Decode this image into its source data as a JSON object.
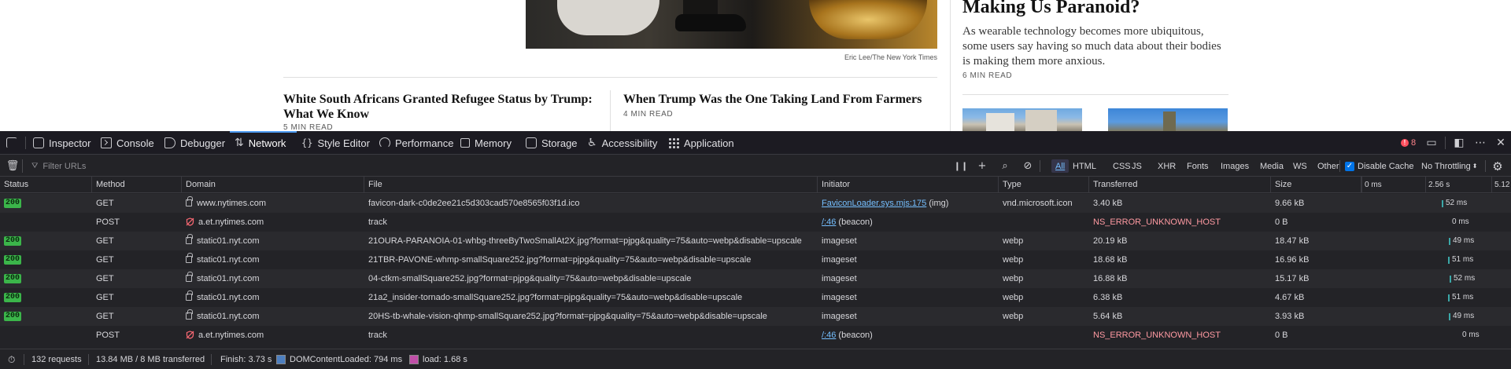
{
  "webpage": {
    "hero_caption": "Eric Lee/The New York Times",
    "story_left_title": "White South Africans Granted Refugee Status by Trump: What We Know",
    "story_left_readtime": "5 MIN READ",
    "story_right_title": "When Trump Was the One Taking Land From Farmers",
    "story_right_readtime": "4 MIN READ",
    "side_title": "Making Us Paranoid?",
    "side_summary": "As wearable technology becomes more ubiquitous, some users say having so much data about their bodies is making them more anxious.",
    "side_readtime": "6 MIN READ"
  },
  "devtools": {
    "tabs": [
      {
        "label": "Inspector",
        "icon": "inspector-icon"
      },
      {
        "label": "Console",
        "icon": "console-icon"
      },
      {
        "label": "Debugger",
        "icon": "debugger-icon"
      },
      {
        "label": "Network",
        "icon": "network-icon"
      },
      {
        "label": "Style Editor",
        "icon": "style-editor-icon"
      },
      {
        "label": "Performance",
        "icon": "performance-icon"
      },
      {
        "label": "Memory",
        "icon": "memory-icon"
      },
      {
        "label": "Storage",
        "icon": "storage-icon"
      },
      {
        "label": "Accessibility",
        "icon": "accessibility-icon"
      },
      {
        "label": "Application",
        "icon": "application-icon"
      }
    ],
    "active_tab": "Network",
    "error_count": "8",
    "filter_placeholder": "Filter URLs",
    "type_filters": [
      "All",
      "HTML",
      "CSS",
      "JS",
      "XHR",
      "Fonts",
      "Images",
      "Media",
      "WS",
      "Other"
    ],
    "active_filter": "All",
    "disable_cache_label": "Disable Cache",
    "disable_cache_checked": true,
    "throttling": "No Throttling",
    "columns": [
      "Status",
      "Method",
      "Domain",
      "File",
      "Initiator",
      "Type",
      "Transferred",
      "Size"
    ],
    "waterfall_ticks": [
      "0 ms",
      "2.56 s",
      "5.12"
    ],
    "rows": [
      {
        "status": "200",
        "method": "GET",
        "domain": "www.nytimes.com",
        "secure": true,
        "file": "favicon-dark-c0de2ee21c5d303cad570e8565f03f1d.ico",
        "initiator_link": "FaviconLoader.sys.mjs:175",
        "initiator_suffix": "(img)",
        "type": "vnd.microsoft.icon",
        "transferred": "3.40 kB",
        "size": "9.66 kB",
        "duration": "52 ms",
        "error": false
      },
      {
        "status": "",
        "method": "POST",
        "domain": "a.et.nytimes.com",
        "secure": false,
        "file": "track",
        "initiator_link": "/:46",
        "initiator_suffix": "(beacon)",
        "type": "",
        "transferred": "NS_ERROR_UNKNOWN_HOST",
        "size": "0 B",
        "duration": "0 ms",
        "error": true
      },
      {
        "status": "200",
        "method": "GET",
        "domain": "static01.nyt.com",
        "secure": true,
        "file": "21OURA-PARANOIA-01-whbg-threeByTwoSmallAt2X.jpg?format=pjpg&quality=75&auto=webp&disable=upscale",
        "initiator_link": "",
        "initiator_suffix": "imageset",
        "type": "webp",
        "transferred": "20.19 kB",
        "size": "18.47 kB",
        "duration": "49 ms",
        "error": false
      },
      {
        "status": "200",
        "method": "GET",
        "domain": "static01.nyt.com",
        "secure": true,
        "file": "21TBR-PAVONE-whmp-smallSquare252.jpg?format=pjpg&quality=75&auto=webp&disable=upscale",
        "initiator_link": "",
        "initiator_suffix": "imageset",
        "type": "webp",
        "transferred": "18.68 kB",
        "size": "16.96 kB",
        "duration": "51 ms",
        "error": false
      },
      {
        "status": "200",
        "method": "GET",
        "domain": "static01.nyt.com",
        "secure": true,
        "file": "04-ctkm-smallSquare252.jpg?format=pjpg&quality=75&auto=webp&disable=upscale",
        "initiator_link": "",
        "initiator_suffix": "imageset",
        "type": "webp",
        "transferred": "16.88 kB",
        "size": "15.17 kB",
        "duration": "52 ms",
        "error": false
      },
      {
        "status": "200",
        "method": "GET",
        "domain": "static01.nyt.com",
        "secure": true,
        "file": "21a2_insider-tornado-smallSquare252.jpg?format=pjpg&quality=75&auto=webp&disable=upscale",
        "initiator_link": "",
        "initiator_suffix": "imageset",
        "type": "webp",
        "transferred": "6.38 kB",
        "size": "4.67 kB",
        "duration": "51 ms",
        "error": false
      },
      {
        "status": "200",
        "method": "GET",
        "domain": "static01.nyt.com",
        "secure": true,
        "file": "20HS-tb-whale-vision-qhmp-smallSquare252.jpg?format=pjpg&quality=75&auto=webp&disable=upscale",
        "initiator_link": "",
        "initiator_suffix": "imageset",
        "type": "webp",
        "transferred": "5.64 kB",
        "size": "3.93 kB",
        "duration": "49 ms",
        "error": false
      },
      {
        "status": "",
        "method": "POST",
        "domain": "a.et.nytimes.com",
        "secure": false,
        "file": "track",
        "initiator_link": "/:46",
        "initiator_suffix": "(beacon)",
        "type": "",
        "transferred": "NS_ERROR_UNKNOWN_HOST",
        "size": "0 B",
        "duration": "0 ms",
        "error": true
      }
    ],
    "statusbar": {
      "requests": "132 requests",
      "transferred": "13.84 MB / 8 MB transferred",
      "finish": "Finish: 3.73 s",
      "dom_content_loaded": "DOMContentLoaded: 794 ms",
      "load": "load: 1.68 s"
    },
    "colors": {
      "dom_content_loaded": "#4d7fc0",
      "load": "#c04fa8",
      "status_ok": "#3bb54a",
      "link": "#75bfff",
      "error": "#ff9aa2",
      "active_tab_underline": "#4d9bf2"
    }
  }
}
